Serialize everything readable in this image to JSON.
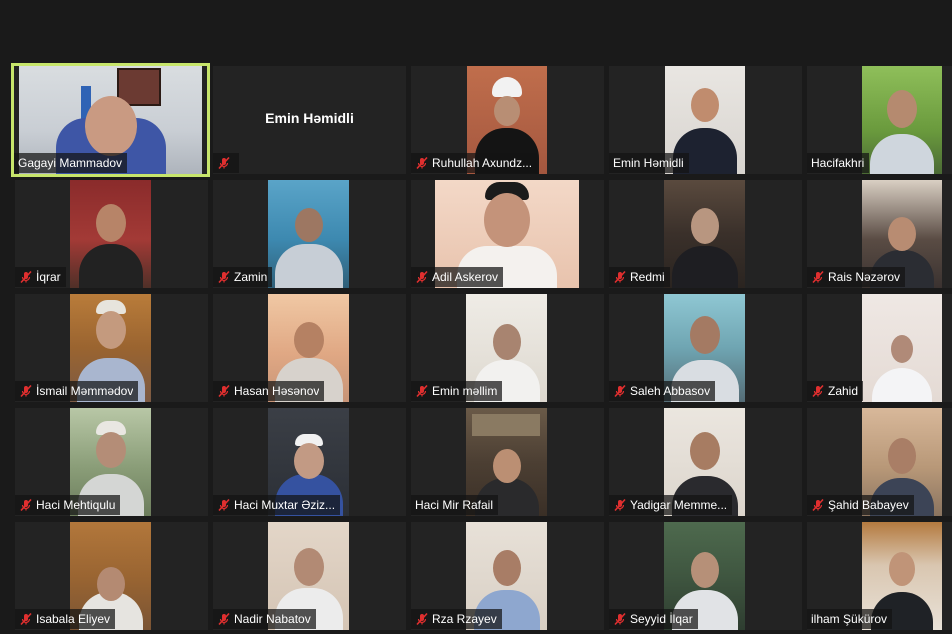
{
  "featured_label": "Emin Həmidli",
  "colors": {
    "active_border": "#c7e56b",
    "mute_icon": "#e02f2f",
    "tile_bg": "#232323",
    "page_bg": "#1a1a1a"
  },
  "tiles": [
    {
      "name": "Gagayi Mammadov",
      "muted": false,
      "active": true
    },
    {
      "name": "",
      "muted": true,
      "active": false,
      "placeholder": "Emin Həmidli"
    },
    {
      "name": "Ruhullah Axundz...",
      "muted": true
    },
    {
      "name": "Emin Həmidli",
      "muted": false
    },
    {
      "name": "Hacifakhri",
      "muted": false
    },
    {
      "name": "İqrar",
      "muted": true
    },
    {
      "name": "Zamin",
      "muted": true
    },
    {
      "name": "Adil Askerov",
      "muted": true
    },
    {
      "name": "Redmi",
      "muted": true
    },
    {
      "name": "Rais Nəzərov",
      "muted": true
    },
    {
      "name": "İsmail Məmmədov",
      "muted": true
    },
    {
      "name": "Hasan Həsənov",
      "muted": true
    },
    {
      "name": "Emin məllim",
      "muted": true
    },
    {
      "name": "Saleh Abbasov",
      "muted": true
    },
    {
      "name": "Zahid",
      "muted": true
    },
    {
      "name": "Haci Mehtiqulu",
      "muted": true
    },
    {
      "name": "Haci Muxtar Əziz...",
      "muted": true
    },
    {
      "name": "Haci Mir Rafail",
      "muted": false
    },
    {
      "name": "Yadigar Memme...",
      "muted": true
    },
    {
      "name": "Şahid Babayev",
      "muted": true
    },
    {
      "name": "Isabala Eliyev",
      "muted": true
    },
    {
      "name": "Nadir Nabatov",
      "muted": true
    },
    {
      "name": "Rza Rzayev",
      "muted": true
    },
    {
      "name": "Seyyid İlqar",
      "muted": true
    },
    {
      "name": "ilham Şükürov",
      "muted": false
    }
  ]
}
